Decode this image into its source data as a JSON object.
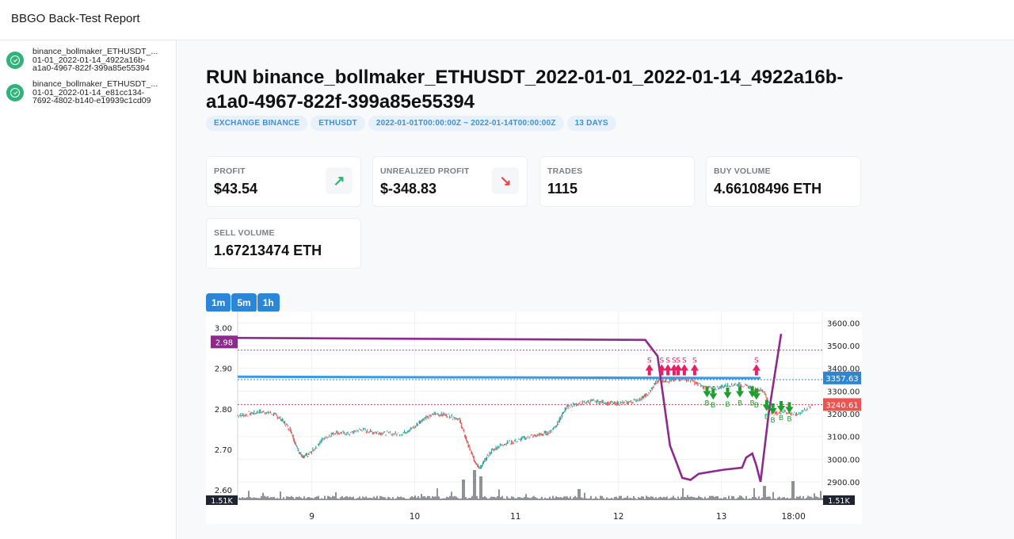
{
  "app": {
    "title": "BBGO Back-Test Report"
  },
  "sidebar": {
    "runs": [
      {
        "label": "binance_bollmaker_ETHUSDT_...\n01-01_2022-01-14_4922a16b-\na1a0-4967-822f-399a85e55394",
        "status": "success"
      },
      {
        "label": "binance_bollmaker_ETHUSDT_...\n01-01_2022-01-14_e81cc134-\n7692-4802-b140-e19939c1cd09",
        "status": "success"
      }
    ]
  },
  "report": {
    "title": "RUN binance_bollmaker_ETHUSDT_2022-01-01_2022-01-14_4922a16b-a1a0-4967-822f-399a85e55394",
    "badges": [
      "EXCHANGE BINANCE",
      "ETHUSDT",
      "2022-01-01T00:00:00Z ~ 2022-01-14T00:00:00Z",
      "13 DAYS"
    ],
    "cards": [
      {
        "label": "PROFIT",
        "value": "$43.54",
        "icon": "arrow-up-right-icon",
        "trend": "up"
      },
      {
        "label": "UNREALIZED PROFIT",
        "value": "$-348.83",
        "icon": "arrow-down-right-icon",
        "trend": "down"
      },
      {
        "label": "TRADES",
        "value": "1115"
      },
      {
        "label": "BUY VOLUME",
        "value": "4.66108496 ETH"
      },
      {
        "label": "SELL VOLUME",
        "value": "1.67213474 ETH"
      }
    ],
    "intervals": [
      "1m",
      "5m",
      "1h"
    ]
  },
  "chart_data": {
    "type": "line",
    "title": "",
    "xlabel": "",
    "ylabel": "",
    "x_ticks": [
      "9",
      "10",
      "11",
      "12",
      "13",
      "18:00"
    ],
    "left_axis": {
      "ticks": [
        "3.00",
        "2.90",
        "2.80",
        "2.70",
        "2.60"
      ],
      "range": [
        2.575,
        3.04
      ],
      "current_label": "2.98"
    },
    "right_axis": {
      "ticks": [
        "3600.00",
        "3500.00",
        "3400.00",
        "3300.00",
        "3200.00",
        "3100.00",
        "3000.00",
        "2900.00"
      ],
      "range": [
        2820,
        3650
      ]
    },
    "price_labels": {
      "last": "3240.61",
      "position_avg": "3357.63"
    },
    "volume_label": "1.51K",
    "series": [
      {
        "name": "price",
        "type": "candlestick",
        "axis": "right",
        "points": [
          [
            0,
            3190
          ],
          [
            0.03,
            3200
          ],
          [
            0.06,
            3210
          ],
          [
            0.09,
            3200
          ],
          [
            0.11,
            3170
          ],
          [
            0.13,
            3130
          ],
          [
            0.145,
            3050
          ],
          [
            0.16,
            3005
          ],
          [
            0.18,
            3030
          ],
          [
            0.21,
            3090
          ],
          [
            0.24,
            3120
          ],
          [
            0.27,
            3110
          ],
          [
            0.3,
            3130
          ],
          [
            0.33,
            3120
          ],
          [
            0.36,
            3115
          ],
          [
            0.4,
            3110
          ],
          [
            0.43,
            3140
          ],
          [
            0.45,
            3175
          ],
          [
            0.48,
            3200
          ],
          [
            0.51,
            3195
          ],
          [
            0.54,
            3175
          ],
          [
            0.56,
            3070
          ],
          [
            0.575,
            3000
          ],
          [
            0.59,
            2960
          ],
          [
            0.6,
            2990
          ],
          [
            0.62,
            3040
          ],
          [
            0.65,
            3070
          ],
          [
            0.68,
            3080
          ],
          [
            0.71,
            3100
          ],
          [
            0.74,
            3110
          ],
          [
            0.76,
            3120
          ],
          [
            0.78,
            3160
          ],
          [
            0.8,
            3230
          ],
          [
            0.83,
            3245
          ],
          [
            0.86,
            3255
          ],
          [
            0.89,
            3250
          ],
          [
            0.92,
            3245
          ],
          [
            0.95,
            3250
          ],
          [
            0.98,
            3265
          ],
          [
            1.0,
            3290
          ],
          [
            1.02,
            3345
          ],
          [
            1.05,
            3345
          ],
          [
            1.07,
            3355
          ],
          [
            1.1,
            3350
          ],
          [
            1.13,
            3320
          ],
          [
            1.16,
            3310
          ],
          [
            1.19,
            3325
          ],
          [
            1.22,
            3330
          ],
          [
            1.25,
            3315
          ],
          [
            1.28,
            3300
          ],
          [
            1.3,
            3200
          ],
          [
            1.33,
            3210
          ],
          [
            1.36,
            3195
          ],
          [
            1.4,
            3240
          ]
        ]
      },
      {
        "name": "profit",
        "type": "line",
        "axis": "left",
        "color": "#8e2a8e",
        "points": [
          [
            0,
            2.975
          ],
          [
            0.99,
            2.97
          ],
          [
            1.005,
            2.95
          ],
          [
            1.02,
            2.93
          ],
          [
            1.05,
            2.71
          ],
          [
            1.08,
            2.63
          ],
          [
            1.1,
            2.625
          ],
          [
            1.12,
            2.64
          ],
          [
            1.18,
            2.65
          ],
          [
            1.225,
            2.655
          ],
          [
            1.235,
            2.68
          ],
          [
            1.25,
            2.69
          ],
          [
            1.26,
            2.66
          ],
          [
            1.27,
            2.62
          ],
          [
            1.29,
            2.79
          ],
          [
            1.32,
            2.985
          ]
        ]
      },
      {
        "name": "position_avg_cost",
        "type": "line",
        "axis": "right",
        "color": "#2b86d8",
        "points": [
          [
            0,
            3363
          ],
          [
            1.27,
            3357
          ]
        ]
      }
    ],
    "markers": {
      "sell": {
        "label": "S",
        "color": "#e91e63",
        "count_visible": 8
      },
      "buy": {
        "label": "B",
        "color": "#1e9e2f",
        "count_visible": 10
      }
    },
    "grid": true,
    "legend": "none"
  }
}
